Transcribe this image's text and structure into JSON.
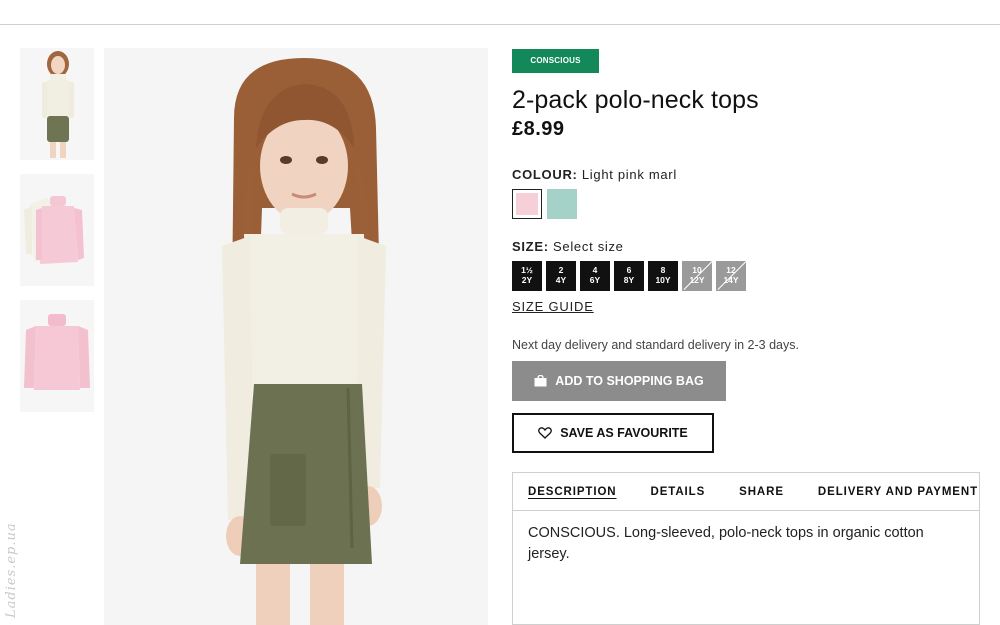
{
  "watermark": "Ladies.ep.ua",
  "thumbnails": [
    {
      "alt": "Child wearing cream top and green skirt"
    },
    {
      "alt": "Cream and pink polo-neck tops"
    },
    {
      "alt": "Pink polo-neck top"
    }
  ],
  "product": {
    "badge": "CONSCIOUS",
    "title": "2-pack polo-neck tops",
    "price": "£8.99"
  },
  "colour": {
    "label": "COLOUR:",
    "selected": "Light pink marl",
    "swatches": [
      {
        "name": "Light pink marl",
        "color": "#f6cfd9",
        "selected": true
      },
      {
        "name": "Mint",
        "color": "#a4d1c8",
        "selected": false
      }
    ]
  },
  "size": {
    "label": "SIZE:",
    "placeholder": "Select size",
    "options": [
      {
        "line1": "1½",
        "line2": "2Y",
        "available": true
      },
      {
        "line1": "2",
        "line2": "4Y",
        "available": true
      },
      {
        "line1": "4",
        "line2": "6Y",
        "available": true
      },
      {
        "line1": "6",
        "line2": "8Y",
        "available": true
      },
      {
        "line1": "8",
        "line2": "10Y",
        "available": true
      },
      {
        "line1": "10",
        "line2": "12Y",
        "available": false
      },
      {
        "line1": "12",
        "line2": "14Y",
        "available": false
      }
    ],
    "guide_label": "SIZE GUIDE"
  },
  "delivery_text": "Next day delivery and standard delivery in 2-3 days.",
  "buttons": {
    "add_to_bag": "ADD TO SHOPPING BAG",
    "add_to_bag_icon": "shopping-bag-icon",
    "save_favourite": "SAVE AS FAVOURITE",
    "save_favourite_icon": "heart-icon"
  },
  "tabs": [
    {
      "label": "DESCRIPTION",
      "active": true
    },
    {
      "label": "DETAILS",
      "active": false
    },
    {
      "label": "SHARE",
      "active": false
    },
    {
      "label": "DELIVERY AND PAYMENT",
      "active": false
    }
  ],
  "description": "CONSCIOUS. Long-sleeved, polo-neck tops in organic cotton jersey."
}
